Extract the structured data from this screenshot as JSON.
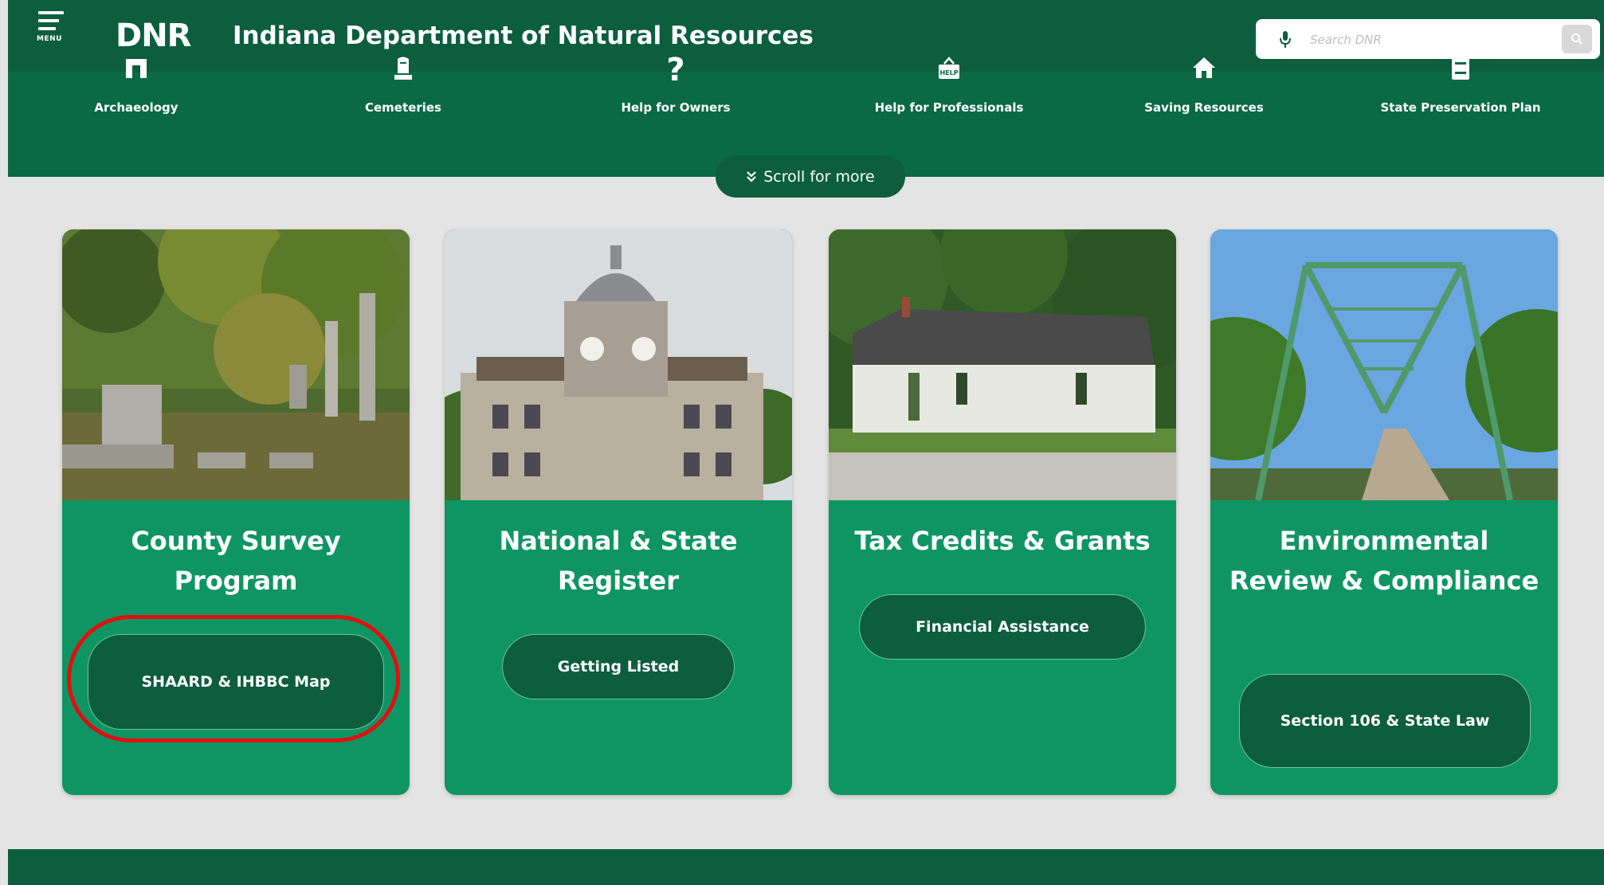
{
  "header": {
    "menu_label": "MENU",
    "logo": "DNR",
    "title": "Indiana Department of Natural Resources",
    "search_placeholder": "Search DNR"
  },
  "nav": [
    {
      "label": "Archaeology",
      "icon": "archaeology-icon"
    },
    {
      "label": "Cemeteries",
      "icon": "tombstone-icon"
    },
    {
      "label": "Help for Owners",
      "icon": "question-icon"
    },
    {
      "label": "Help for Professionals",
      "icon": "help-sign-icon"
    },
    {
      "label": "Saving Resources",
      "icon": "house-icon"
    },
    {
      "label": "State Preservation Plan",
      "icon": "book-icon"
    }
  ],
  "scroll_more": "Scroll for more",
  "cards": [
    {
      "title": "County Survey Program",
      "button": "SHAARD & IHBBC Map",
      "photo": "cemetery-photo"
    },
    {
      "title": "National & State Register",
      "button": "Getting Listed",
      "photo": "courthouse-photo"
    },
    {
      "title": "Tax Credits & Grants",
      "button": "Financial Assistance",
      "photo": "house-photo"
    },
    {
      "title": "Environmental Review & Compliance",
      "button": "Section 106 & State Law",
      "photo": "bridge-photo"
    }
  ],
  "colors": {
    "header_dark": "#0c5e3e",
    "header": "#0a6a45",
    "card": "#0f9563",
    "highlight": "#e01010",
    "background": "#e4e4e4"
  }
}
